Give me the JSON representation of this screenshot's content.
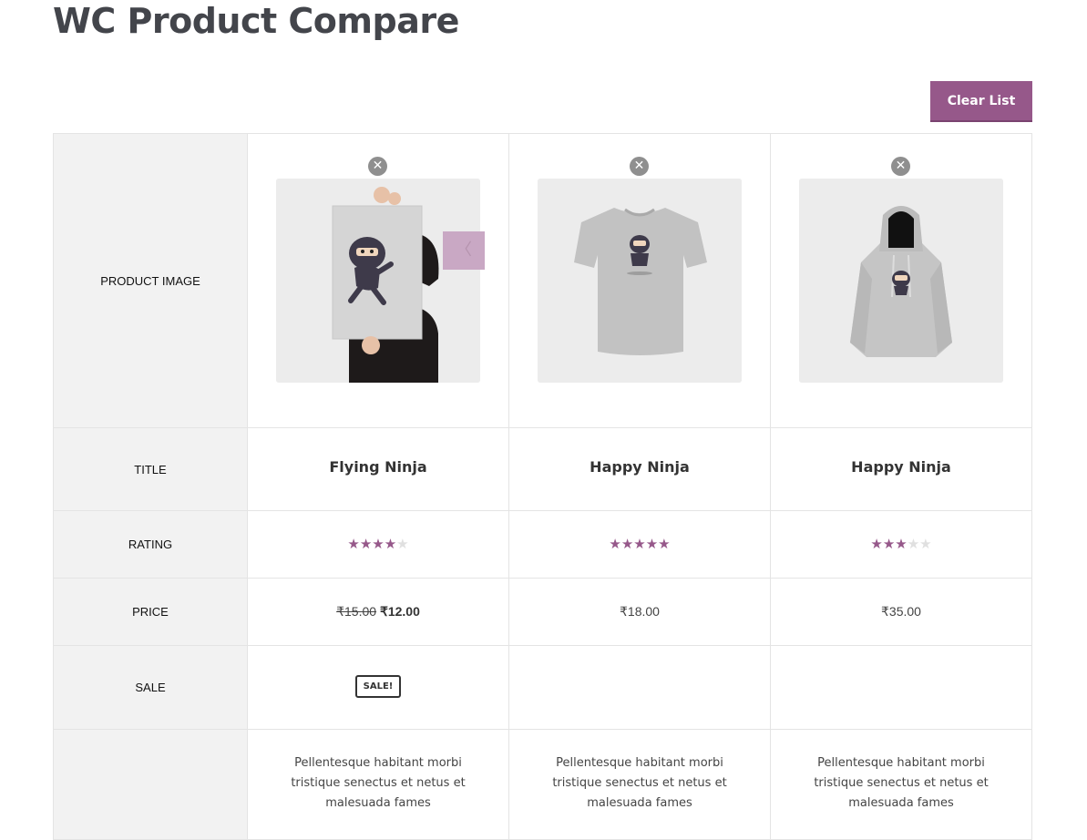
{
  "page": {
    "title": "WC Product Compare",
    "clear_label": "Clear List"
  },
  "labels": {
    "image": "PRODUCT IMAGE",
    "title": "TITLE",
    "rating": "RATING",
    "price": "PRICE",
    "sale": "SALE"
  },
  "remove_symbol": "✕",
  "prev_symbol": "〈",
  "products": [
    {
      "image": "poster-image",
      "title": "Flying Ninja",
      "rating": 4,
      "rating_max": 5,
      "price_regular": "₹15.00",
      "price_sale": "₹12.00",
      "sale_badge": "SALE!",
      "description": "Pellentesque habitant morbi tristique senectus et netus et malesuada fames"
    },
    {
      "image": "tshirt-image",
      "title": "Happy Ninja",
      "rating": 5,
      "rating_max": 5,
      "price": "₹18.00",
      "description": "Pellentesque habitant morbi tristique senectus et netus et malesuada fames"
    },
    {
      "image": "hoodie-image",
      "title": "Happy Ninja",
      "rating": 3,
      "rating_max": 5,
      "price": "₹35.00",
      "description": "Pellentesque habitant morbi tristique senectus et netus et malesuada fames"
    }
  ],
  "colors": {
    "accent": "#96588a",
    "label_bg": "#f2f2f2",
    "border": "#e4e4e4"
  }
}
